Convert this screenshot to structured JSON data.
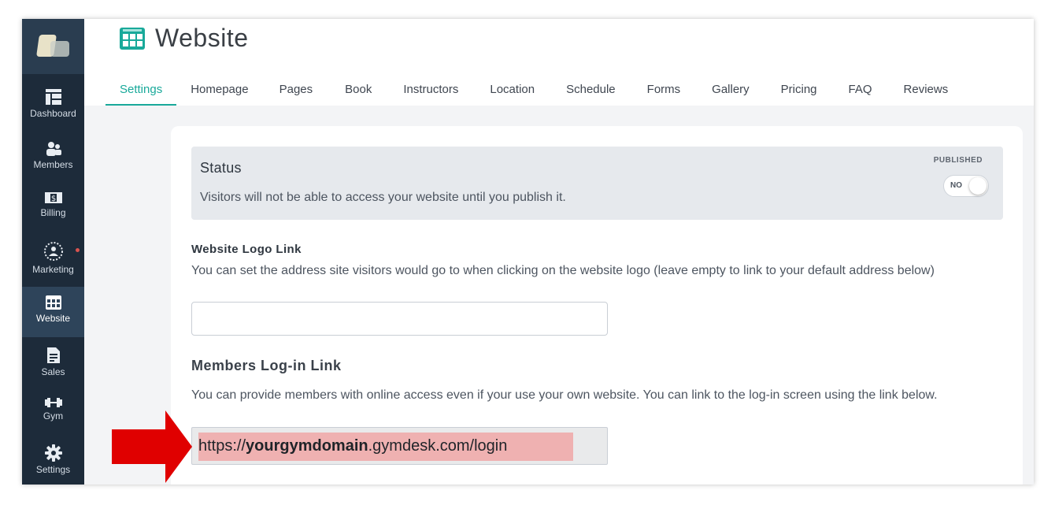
{
  "app": {
    "colors": {
      "accent": "#19a99a",
      "sidebar": "#1d2b3a",
      "arrow": "#e00000",
      "highlight": "#efb1b1"
    }
  },
  "sidebar": {
    "items": [
      {
        "label": "Dashboard",
        "icon": "dashboard-icon"
      },
      {
        "label": "Members",
        "icon": "members-icon"
      },
      {
        "label": "Billing",
        "icon": "billing-icon"
      },
      {
        "label": "Marketing",
        "icon": "marketing-icon"
      },
      {
        "label": "Website",
        "icon": "website-icon",
        "active": true
      },
      {
        "label": "Sales",
        "icon": "sales-icon"
      },
      {
        "label": "Gym",
        "icon": "dumbbell-icon"
      },
      {
        "label": "Settings",
        "icon": "gear-icon"
      }
    ]
  },
  "header": {
    "title": "Website",
    "tabs": [
      "Settings",
      "Homepage",
      "Pages",
      "Book",
      "Instructors",
      "Location",
      "Schedule",
      "Forms",
      "Gallery",
      "Pricing",
      "FAQ",
      "Reviews"
    ],
    "active_tab": "Settings"
  },
  "status": {
    "title": "Status",
    "description": "Visitors will not be able to access your website until you publish it.",
    "published_label": "PUBLISHED",
    "toggle_value": "NO"
  },
  "logo_link": {
    "label": "Website Logo Link",
    "help": "You can set the address site visitors would go to when clicking on the website logo (leave empty to link to your default address below)",
    "value": ""
  },
  "members_login": {
    "label": "Members Log-in Link",
    "help": "You can provide members with online access even if your use your own website. You can link to the log-in screen using the link below.",
    "url_prefix": "https://",
    "url_domain": "yourgymdomain",
    "url_suffix": ".gymdesk.com/login"
  }
}
